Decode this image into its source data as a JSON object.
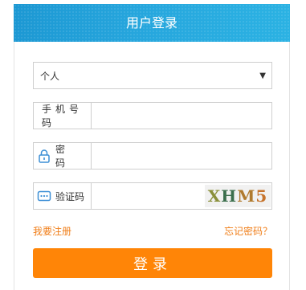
{
  "header": {
    "title": "用户登录"
  },
  "form": {
    "role_select": {
      "selected": "个人"
    },
    "phone": {
      "label": "手机号码"
    },
    "password": {
      "label": "密码"
    },
    "captcha": {
      "label": "验证码",
      "image_text": [
        "X",
        "H",
        "M",
        "5"
      ]
    }
  },
  "links": {
    "register": "我要注册",
    "forgot": "忘记密码？"
  },
  "login_button": "登录",
  "colors": {
    "header": "#24a4dc",
    "accent": "#ff8507",
    "link": "#f07d17",
    "icon": "#3d8fd6"
  },
  "icons": {
    "lock": "lock-icon",
    "captcha": "keyboard-icon",
    "dropdown": "triangle-down-icon"
  }
}
